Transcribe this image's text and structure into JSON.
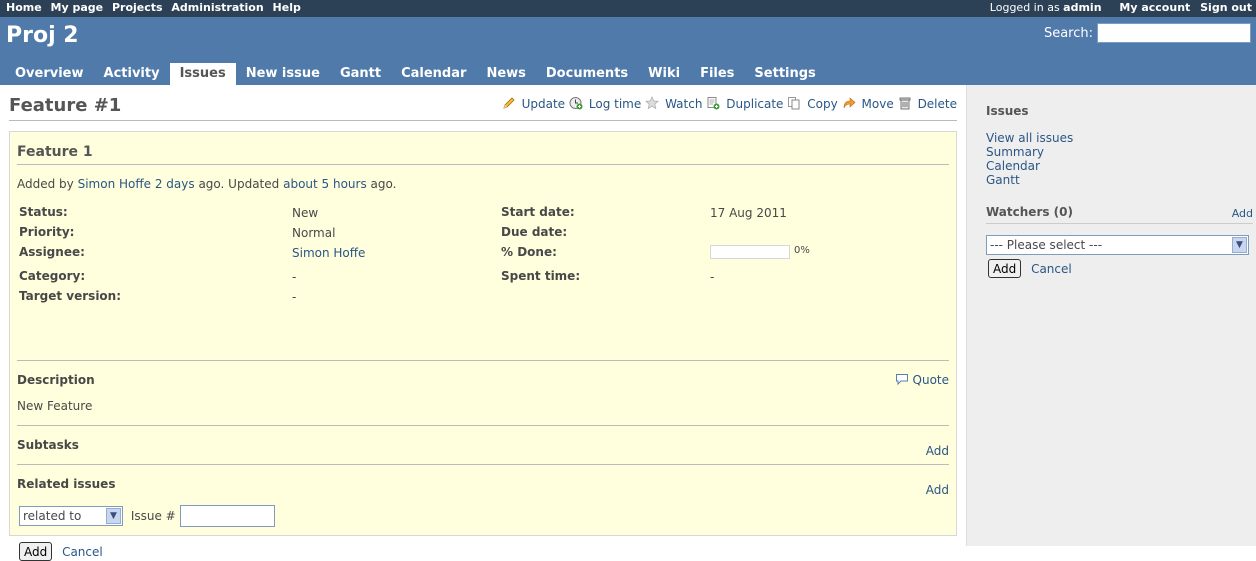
{
  "top_menu": {
    "left": [
      "Home",
      "My page",
      "Projects",
      "Administration",
      "Help"
    ],
    "logged_prefix": "Logged in as",
    "user": "admin",
    "my_account": "My account",
    "sign_out": "Sign out"
  },
  "header": {
    "project": "Proj 2",
    "search_label": "Search:"
  },
  "main_menu": [
    "Overview",
    "Activity",
    "Issues",
    "New issue",
    "Gantt",
    "Calendar",
    "News",
    "Documents",
    "Wiki",
    "Files",
    "Settings"
  ],
  "main_menu_selected": "Issues",
  "issue": {
    "heading": "Feature #1",
    "actions": [
      "Update",
      "Log time",
      "Watch",
      "Duplicate",
      "Copy",
      "Move",
      "Delete"
    ],
    "subject": "Feature 1",
    "added_by_prefix": "Added by",
    "author": "Simon Hoffe",
    "added_ago": "2 days",
    "ago_updated": "ago. Updated",
    "updated_ago": "about 5 hours",
    "ago_end": "ago.",
    "labels": {
      "status": "Status:",
      "priority": "Priority:",
      "assignee": "Assignee:",
      "category": "Category:",
      "target_version": "Target version:",
      "start_date": "Start date:",
      "due_date": "Due date:",
      "done": "% Done:",
      "spent_time": "Spent time:"
    },
    "values": {
      "status": "New",
      "priority": "Normal",
      "assignee": "Simon Hoffe",
      "category": "-",
      "target_version": "-",
      "start_date": "17 Aug 2011",
      "due_date": "",
      "done_pct": 0,
      "done_label": "0%",
      "spent_time": "-"
    },
    "description_title": "Description",
    "quote": "Quote",
    "description": "New Feature",
    "subtasks_title": "Subtasks",
    "subtasks_add": "Add",
    "related_title": "Related issues",
    "related_add": "Add",
    "relation_selected": "related to",
    "issue_num_label": "Issue #",
    "add_button": "Add",
    "cancel": "Cancel"
  },
  "sidebar": {
    "issues_title": "Issues",
    "links": [
      "View all issues",
      "Summary",
      "Calendar",
      "Gantt"
    ],
    "watchers_title": "Watchers (0)",
    "watchers_add": "Add",
    "select_placeholder": "--- Please select ---",
    "add_button": "Add",
    "cancel": "Cancel"
  }
}
